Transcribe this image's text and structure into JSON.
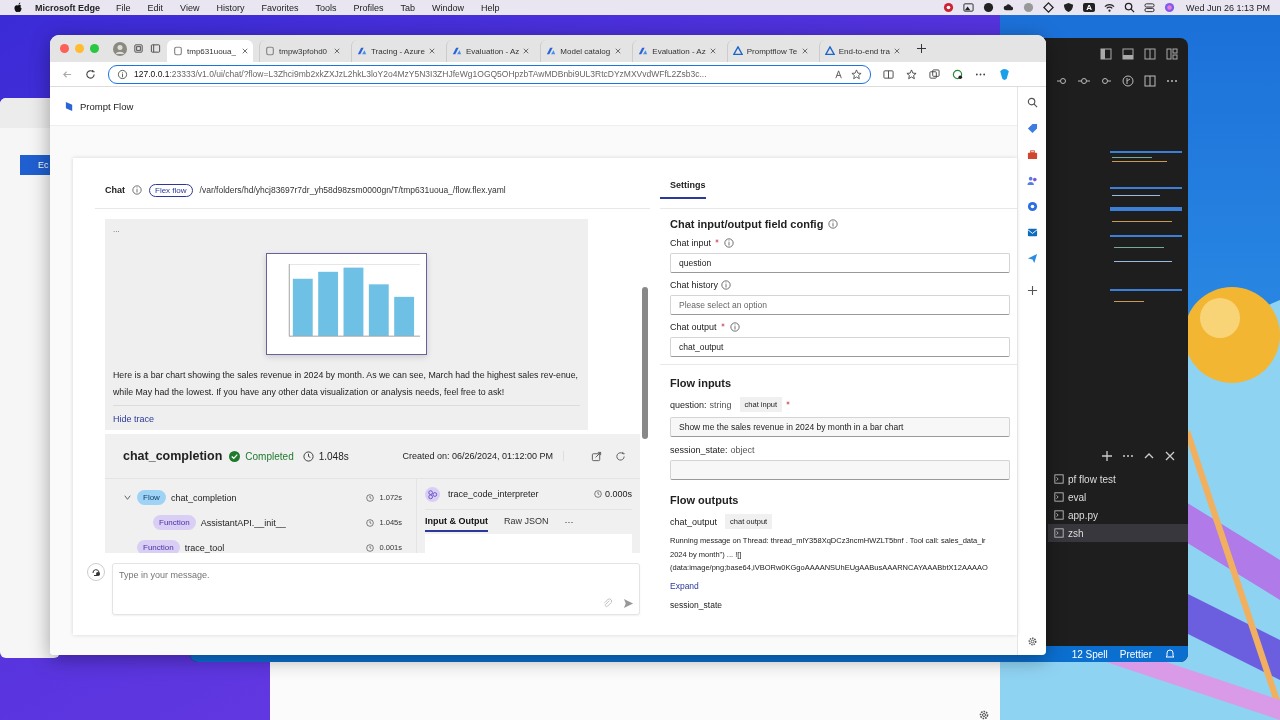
{
  "menubar": {
    "app": "Microsoft Edge",
    "menus": [
      "File",
      "Edit",
      "View",
      "History",
      "Favorites",
      "Tools",
      "Profiles",
      "Tab",
      "Window",
      "Help"
    ],
    "input_source": "A",
    "clock": "Wed Jun 26  1:13 PM"
  },
  "browser": {
    "tabs": [
      {
        "label": "tmp631uoua_",
        "selected": true,
        "kind": "promptflow"
      },
      {
        "label": "tmpw3pfohd0",
        "selected": false,
        "kind": "promptflow"
      },
      {
        "label": "Tracing - Azure",
        "selected": false,
        "kind": "azure"
      },
      {
        "label": "Evaluation - Az",
        "selected": false,
        "kind": "azure"
      },
      {
        "label": "Model catalog",
        "selected": false,
        "kind": "azure"
      },
      {
        "label": "Evaluation - Az",
        "selected": false,
        "kind": "azure"
      },
      {
        "label": "Promptflow Te",
        "selected": false,
        "kind": "docs"
      },
      {
        "label": "End-to-end tra",
        "selected": false,
        "kind": "docs"
      }
    ],
    "url_host": "127.0.0.1",
    "url_rest": ":23333/v1.0/ui/chat/?flow=L3Zhci9mb2xkZXJzL2hkL3loY2o4MzY5N3I3ZHJfeWg1OGQ5OHpzbTAwMDBnbi9UL3RtcDYzMXVvdWFfL2Zsb3c..."
  },
  "behind_window": {
    "button": "Ec"
  },
  "app": {
    "title": "Prompt Flow"
  },
  "chat": {
    "title": "Chat",
    "badge": "Flex flow",
    "path": "/var/folders/hd/yhcj83697r7dr_yh58d98zsm0000gn/T/tmp631uoua_/flow.flex.yaml",
    "ellipsis": "...",
    "message": "Here is a bar chart showing the sales revenue in 2024 by month. As we can see, March had the highest sales rev-enue, while May had the lowest. If you have any other data visualization or analysis needs, feel free to ask!",
    "hide_trace": "Hide trace",
    "trace": {
      "name": "chat_completion",
      "status": "Completed",
      "duration": "1.048s",
      "created": "Created on: 06/26/2024, 01:12:00 PM",
      "tree": [
        {
          "kind": "flow",
          "badge": "Flow",
          "name": "chat_completion",
          "duration": "1.072s",
          "expanded": true,
          "children": [
            {
              "kind": "function",
              "badge": "Function",
              "name": "AssistantAPI.__init__",
              "duration": "1.045s"
            }
          ]
        },
        {
          "kind": "function",
          "badge": "Function",
          "name": "trace_tool",
          "duration": "0.001s"
        }
      ],
      "detail": {
        "name": "trace_code_interpreter",
        "duration": "0.000s",
        "tabs": [
          {
            "label": "Input & Output",
            "selected": true
          },
          {
            "label": "Raw JSON",
            "selected": false
          }
        ],
        "more": "···"
      }
    },
    "input": {
      "placeholder": "Type in your message."
    }
  },
  "settings": {
    "tab": "Settings",
    "config_title": "Chat input/output field config",
    "config_fields": [
      {
        "label": "Chat input",
        "required": true,
        "value": "question"
      },
      {
        "label": "Chat history",
        "required": false,
        "placeholder": "Please select an option"
      },
      {
        "label": "Chat output",
        "required": true,
        "value": "chat_output"
      }
    ],
    "inputs_title": "Flow inputs",
    "inputs": [
      {
        "name": "question:",
        "type": "string",
        "tag": "chat input",
        "required": true,
        "value": "Show me the sales revenue in 2024 by month in a bar chart"
      },
      {
        "name": "session_state:",
        "type": "object",
        "required": false
      }
    ],
    "outputs_title": "Flow outputs",
    "output": {
      "name": "chat_output",
      "tag": "chat output",
      "lines": [
        "Running message on Thread: thread_mlY358XqDCz3ncmHWZLT5bnf . Tool call: sales_data_ir",
        "2024 by month\") ... ![]",
        "(data:image/png;base64,iVBORw0KGgoAAAANSUhEUgAABusAAARNCAYAAABbtX12AAAAO"
      ],
      "expand": "Expand"
    },
    "session_state": "session_state"
  },
  "vscode": {
    "terminals": [
      {
        "label": "pf flow test",
        "selected": false
      },
      {
        "label": "eval",
        "selected": false
      },
      {
        "label": "app.py",
        "selected": false
      },
      {
        "label": "zsh",
        "selected": true
      }
    ],
    "spell": "12 Spell",
    "prettier": "Prettier"
  }
}
